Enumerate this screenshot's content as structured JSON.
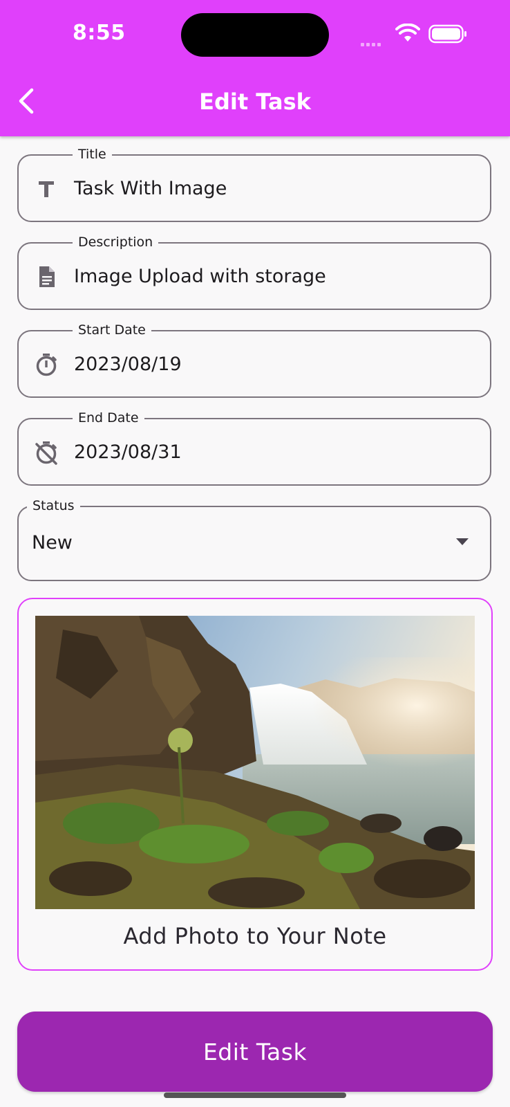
{
  "status_bar": {
    "time": "8:55"
  },
  "appbar": {
    "title": "Edit Task",
    "back_icon": "chevron-left-icon"
  },
  "form": {
    "title": {
      "label": "Title",
      "value": "Task With Image",
      "icon": "text-t-icon"
    },
    "description": {
      "label": "Description",
      "value": "Image Upload with storage",
      "icon": "document-icon"
    },
    "start_date": {
      "label": "Start Date",
      "value": "2023/08/19",
      "icon": "timer-icon"
    },
    "end_date": {
      "label": "End Date",
      "value": "2023/08/31",
      "icon": "timer-off-icon"
    },
    "status": {
      "label": "Status",
      "value": "New",
      "icon": "arrow-drop-down-icon"
    }
  },
  "photo": {
    "caption": "Add Photo to Your Note"
  },
  "submit": {
    "label": "Edit Task"
  },
  "colors": {
    "appbar": "#e040fb",
    "button": "#9c27b0",
    "border": "#7c757e"
  }
}
